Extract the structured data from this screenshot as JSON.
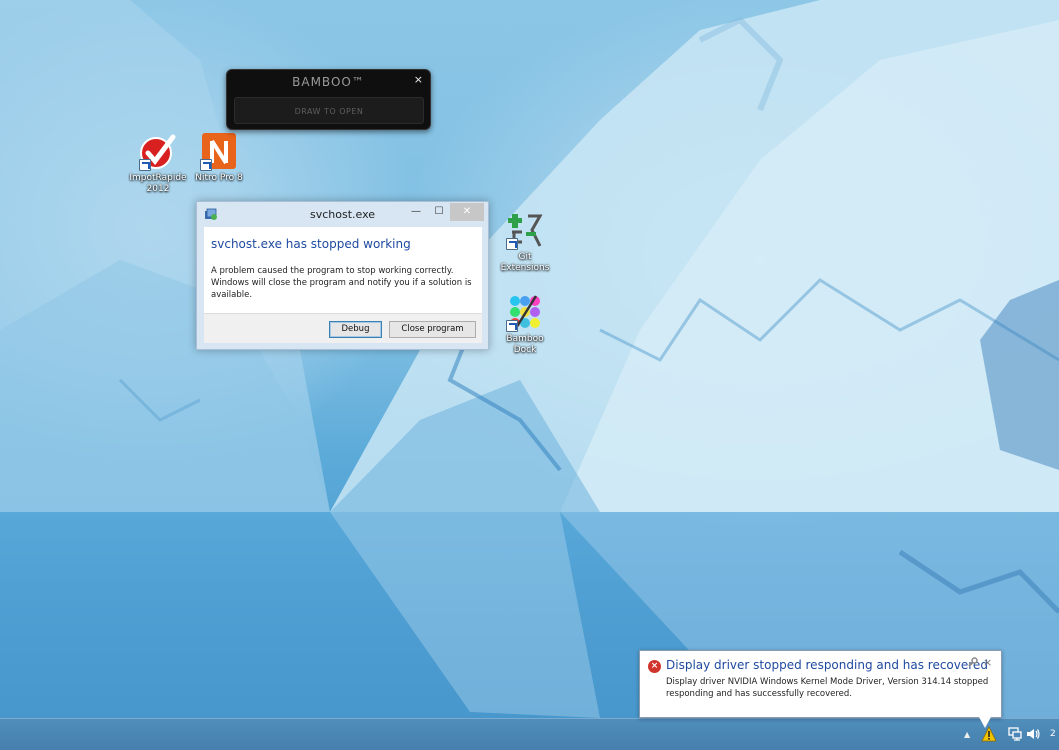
{
  "desktop": {
    "icons": [
      {
        "label": "ImpotRapide 2012",
        "icon": "impotrapide-check-icon"
      },
      {
        "label": "Nitro Pro 8",
        "icon": "nitro-pdf-icon"
      },
      {
        "label": "Git Extensions",
        "icon": "git-extensions-icon"
      },
      {
        "label": "Bamboo Dock",
        "icon": "bamboo-dock-icon"
      }
    ]
  },
  "bamboo_widget": {
    "title": "BAMBOO™",
    "close_label": "×",
    "draw_label": "DRAW TO OPEN"
  },
  "error_dialog": {
    "window_title": "svchost.exe",
    "minimize_label": "—",
    "maximize_label": "☐",
    "close_label": "✕",
    "heading": "svchost.exe has stopped working",
    "message": "A problem caused the program to stop working correctly. Windows will close the program and notify you if a solution is available.",
    "debug_label": "Debug",
    "close_program_label": "Close program"
  },
  "notification": {
    "title": "Display driver stopped responding and has recovered",
    "message": "Display driver NVIDIA Windows Kernel Mode Driver, Version 314.14  stopped responding and has successfully recovered.",
    "close_label": "×",
    "error_glyph": "×",
    "colors": {
      "error": "#d0342c",
      "title": "#1f4aa0"
    }
  },
  "taskbar": {
    "tray_chevron": "▲",
    "clock_fragment": "2"
  }
}
